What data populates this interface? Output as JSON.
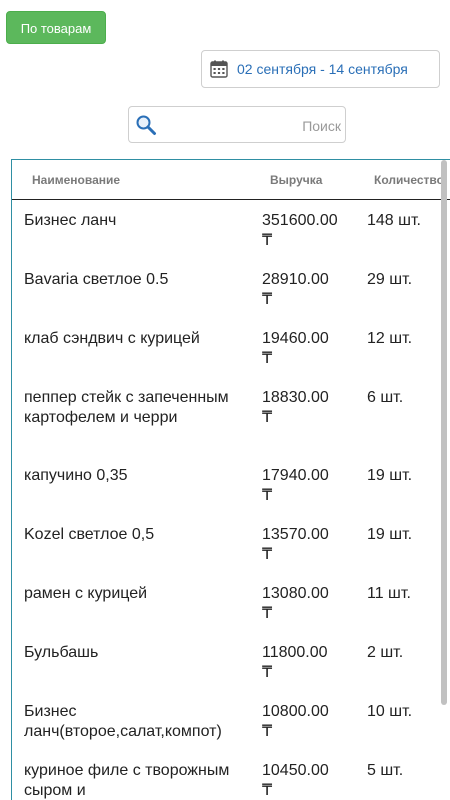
{
  "toolbar": {
    "group_button_label": "По товарам",
    "date_range": "02 сентября - 14 сентября",
    "search_placeholder": "Поиск"
  },
  "table": {
    "headers": {
      "name": "Наименование",
      "revenue": "Выручка",
      "quantity": "Количество"
    },
    "currency_symbol": "₸",
    "rows": [
      {
        "name": "Бизнес ланч",
        "revenue": "351600.00",
        "quantity": "148 шт."
      },
      {
        "name": "Bavaria светлое 0.5",
        "revenue": "28910.00",
        "quantity": "29 шт."
      },
      {
        "name": "клаб сэндвич с курицей",
        "revenue": "19460.00",
        "quantity": "12 шт."
      },
      {
        "name": "пеппер стейк с запеченным картофелем и черри",
        "revenue": "18830.00",
        "quantity": "6 шт."
      },
      {
        "name": "капучино 0,35",
        "revenue": "17940.00",
        "quantity": "19 шт."
      },
      {
        "name": "Kozel светлое 0,5",
        "revenue": "13570.00",
        "quantity": "19 шт."
      },
      {
        "name": "рамен с курицей",
        "revenue": "13080.00",
        "quantity": "11 шт."
      },
      {
        "name": "Бульбашь",
        "revenue": "11800.00",
        "quantity": "2 шт."
      },
      {
        "name": "Бизнес ланч(второе,салат,компот)",
        "revenue": "10800.00",
        "quantity": "10 шт."
      },
      {
        "name": "куриное филе с творожным сыром и",
        "revenue": "10450.00",
        "quantity": "5 шт."
      }
    ]
  },
  "icons": {
    "calendar": "calendar-icon",
    "search": "search-icon"
  },
  "colors": {
    "primary_button": "#5cb85c",
    "link_blue": "#2a6fb7",
    "table_border": "#2f8fa3"
  }
}
